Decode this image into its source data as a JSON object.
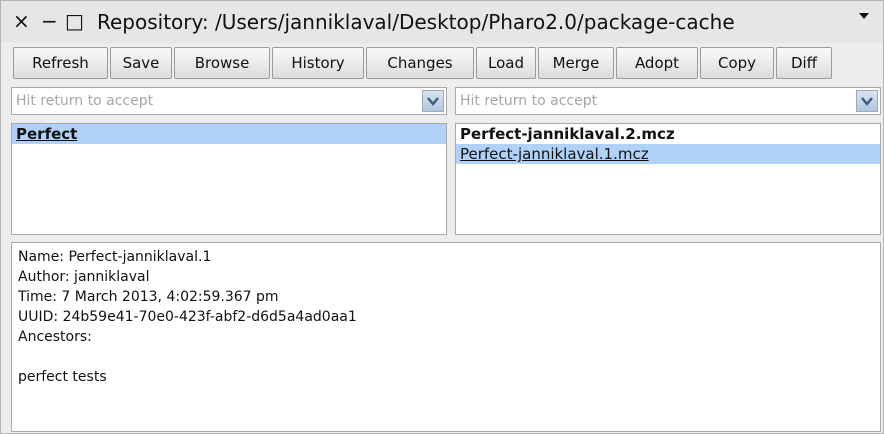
{
  "window": {
    "close_glyph": "×",
    "minimize_glyph": "−",
    "maximize_glyph": "□",
    "title": "Repository: /Users/janniklaval/Desktop/Pharo2.0/package-cache",
    "menu_icon": "triangle-down-icon"
  },
  "toolbar": {
    "refresh": "Refresh",
    "save": "Save",
    "browse": "Browse",
    "history": "History",
    "changes": "Changes",
    "load": "Load",
    "merge": "Merge",
    "adopt": "Adopt",
    "copy": "Copy",
    "diff": "Diff"
  },
  "left_filter": {
    "placeholder": "Hit return to accept",
    "icon": "chevron-down-icon"
  },
  "right_filter": {
    "placeholder": "Hit return to accept",
    "icon": "chevron-down-icon"
  },
  "packages": [
    {
      "label": "Perfect",
      "selected": true
    }
  ],
  "versions": [
    {
      "label": "Perfect-janniklaval.2.mcz",
      "bold": true,
      "selected": false
    },
    {
      "label": "Perfect-janniklaval.1.mcz",
      "bold": false,
      "selected": true
    }
  ],
  "details": {
    "name": "Name: Perfect-janniklaval.1",
    "author": "Author: janniklaval",
    "time": "Time: 7 March 2013, 4:02:59.367 pm",
    "uuid": "UUID: 24b59e41-70e0-423f-abf2-d6d5a4ad0aa1",
    "ancestors": "Ancestors:",
    "blank": "",
    "message": "perfect tests"
  },
  "colors": {
    "selection": "#b0d2f8",
    "window_bg": "#ededed"
  }
}
